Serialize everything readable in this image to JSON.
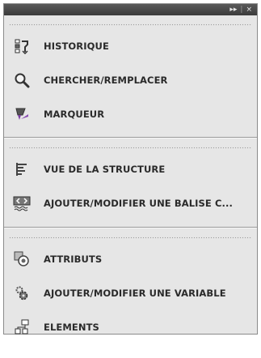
{
  "titlebar": {
    "collapse_icon": "double-chevron-right",
    "close_label": "×"
  },
  "groups": [
    {
      "items": [
        {
          "label": "HISTORIQUE",
          "icon": "history-icon"
        },
        {
          "label": "CHERCHER/REMPLACER",
          "icon": "magnifier-icon"
        },
        {
          "label": "MARQUEUR",
          "icon": "marker-icon"
        }
      ]
    },
    {
      "items": [
        {
          "label": "VUE DE LA STRUCTURE",
          "icon": "structure-tree-icon"
        },
        {
          "label": "AJOUTER/MODIFIER UNE BALISE C...",
          "icon": "tag-icon"
        }
      ]
    },
    {
      "items": [
        {
          "label": "ATTRIBUTS",
          "icon": "attributes-icon"
        },
        {
          "label": "AJOUTER/MODIFIER UNE VARIABLE",
          "icon": "variable-gear-icon"
        },
        {
          "label": "ELEMENTS",
          "icon": "elements-icon"
        }
      ]
    }
  ],
  "colors": {
    "panel_bg": "#e6e6e6",
    "titlebar_bg": "#3f3f3f",
    "label": "#2a2a2a"
  }
}
